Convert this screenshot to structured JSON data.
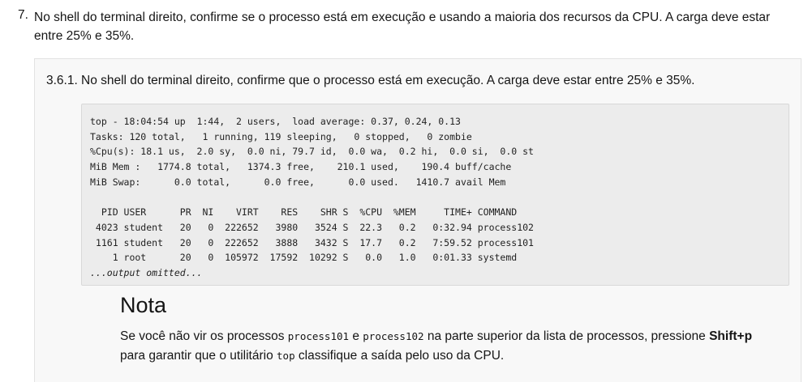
{
  "step": {
    "number": "7.",
    "text": "No shell do terminal direito, confirme se o processo está em execução e usando a maioria dos recursos da CPU. A carga deve estar entre 25% e 35%."
  },
  "substep": {
    "number": "3.6.1.",
    "text": "No shell do terminal direito, confirme que o processo está em execução. A carga deve estar entre 25% e 35%."
  },
  "code": {
    "lines": [
      "top - 18:04:54 up  1:44,  2 users,  load average: 0.37, 0.24, 0.13",
      "Tasks: 120 total,   1 running, 119 sleeping,   0 stopped,   0 zombie",
      "%Cpu(s): 18.1 us,  2.0 sy,  0.0 ni, 79.7 id,  0.0 wa,  0.2 hi,  0.0 si,  0.0 st",
      "MiB Mem :   1774.8 total,   1374.3 free,    210.1 used,    190.4 buff/cache",
      "MiB Swap:      0.0 total,      0.0 free,      0.0 used.   1410.7 avail Mem",
      "",
      "  PID USER      PR  NI    VIRT    RES    SHR S  %CPU  %MEM     TIME+ COMMAND",
      " 4023 student   20   0  222652   3980   3524 S  22.3   0.2   0:32.94 process102",
      " 1161 student   20   0  222652   3888   3432 S  17.7   0.2   7:59.52 process101",
      "    1 root      20   0  105972  17592  10292 S   0.0   1.0   0:01.33 systemd"
    ],
    "omitted": "...output omitted..."
  },
  "note": {
    "title": "Nota",
    "part1": "Se você não vir os processos ",
    "code1": "process101",
    "part2": " e ",
    "code2": "process102",
    "part3": " na parte superior da lista de processos, pressione ",
    "key": "Shift+p",
    "part4": " para garantir que o utilitário ",
    "code3": "top",
    "part5": " classifique a saída pelo uso da CPU."
  }
}
